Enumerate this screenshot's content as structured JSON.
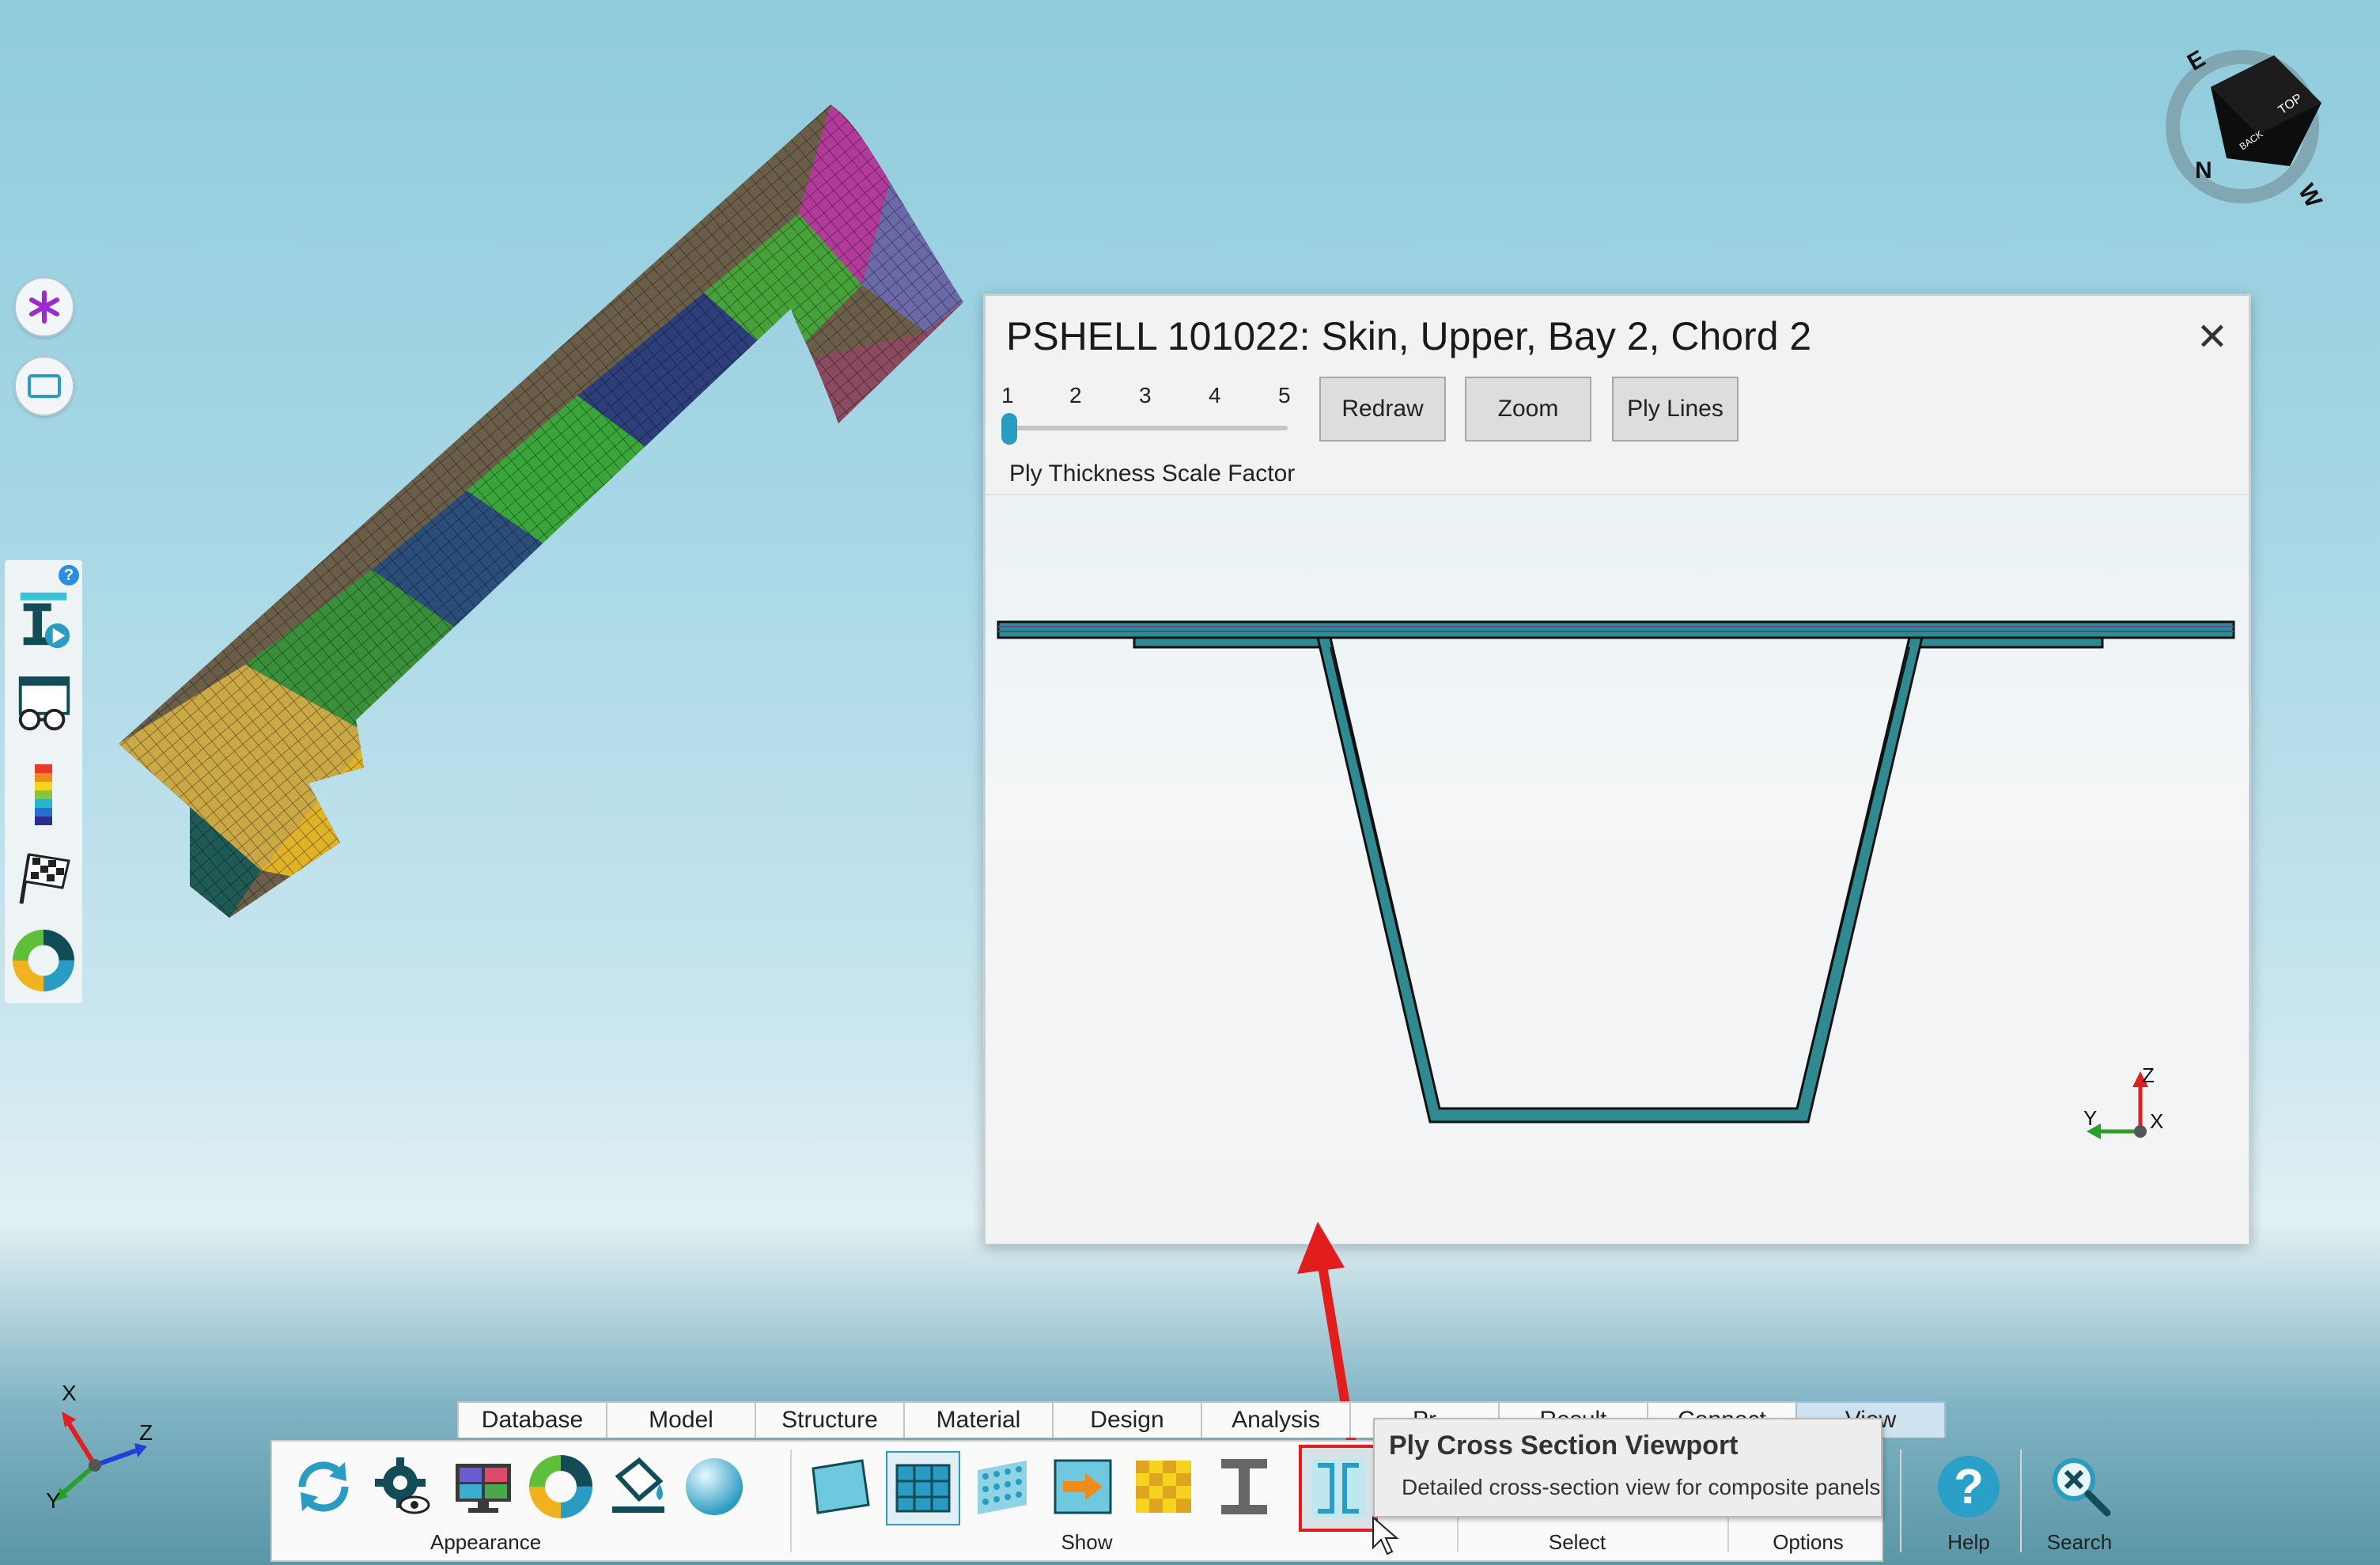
{
  "colors": {
    "accent": "#2a9bc2",
    "highlight_red": "#e21d1d",
    "teal": "#1b8a96"
  },
  "side_toolbar": {
    "help_badge": "?",
    "icons": [
      "create-element-icon",
      "glasses-icon",
      "color-scale-icon",
      "checkered-flag-icon",
      "color-wheel-icon"
    ]
  },
  "popup": {
    "title": "PSHELL 101022: Skin, Upper, Bay 2, Chord 2",
    "close": "✕",
    "ticks": [
      "1",
      "2",
      "3",
      "4",
      "5"
    ],
    "slider_value": 1,
    "slider_label": "Ply Thickness Scale Factor",
    "buttons": {
      "redraw": "Redraw",
      "zoom": "Zoom",
      "ply_lines": "Ply Lines"
    },
    "axis": {
      "z": "Z",
      "y": "Y",
      "x": "X"
    }
  },
  "global_axis": {
    "x": "X",
    "y": "Y",
    "z": "Z"
  },
  "nav_cube": {
    "face_top": "TOP",
    "face_back": "BACK",
    "compass_n": "N",
    "compass_e": "E",
    "compass_w": "W"
  },
  "ribbon": {
    "tabs": [
      "Database",
      "Model",
      "Structure",
      "Material",
      "Design",
      "Analysis",
      "Pr",
      "Result",
      "Connect",
      "View"
    ],
    "active_tab": "View",
    "groups": {
      "appearance": "Appearance",
      "show": "Show",
      "select": "Select",
      "options": "Options",
      "help": "Help",
      "search": "Search"
    },
    "help_glyph": "?"
  },
  "tooltip": {
    "title": "Ply Cross Section Viewport",
    "description": "Detailed cross-section view for composite panels"
  }
}
